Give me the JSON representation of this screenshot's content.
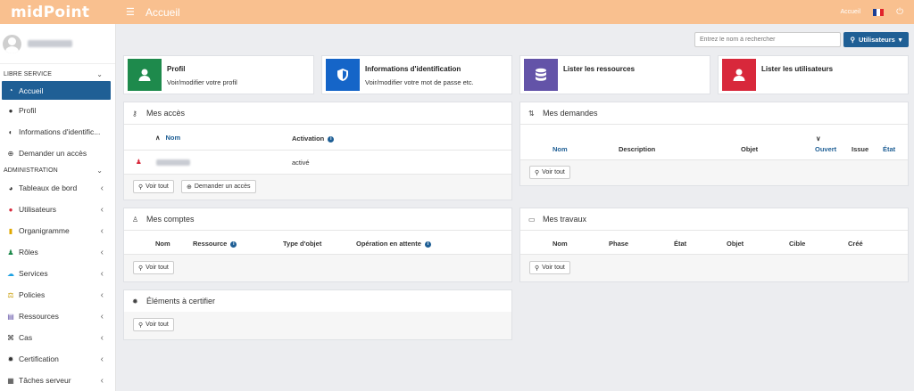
{
  "app": {
    "logo": "midPoint",
    "page_title": "Accueil"
  },
  "topbar": {
    "breadcrumb": "Accueil",
    "flag_colors": [
      "#1c3f94",
      "#ffffff",
      "#e1242b"
    ],
    "power_icon": "power-icon"
  },
  "search": {
    "placeholder": "Entrez le nom à rechercher",
    "type_label": "Utilisateurs"
  },
  "sidebar": {
    "sections": [
      {
        "label": "LIBRE SERVICE"
      },
      {
        "label": "ADMINISTRATION"
      }
    ],
    "self_service": [
      {
        "label": "Accueil",
        "icon": "dashboard-icon",
        "active": true
      },
      {
        "label": "Profil",
        "icon": "user-icon"
      },
      {
        "label": "Informations d'identific...",
        "icon": "shield-icon"
      },
      {
        "label": "Demander un accès",
        "icon": "plus-circle-icon"
      }
    ],
    "admin": [
      {
        "label": "Tableaux de bord",
        "icon": "gauge-icon"
      },
      {
        "label": "Utilisateurs",
        "icon": "user-icon"
      },
      {
        "label": "Organigramme",
        "icon": "building-icon"
      },
      {
        "label": "Rôles",
        "icon": "streetview-icon"
      },
      {
        "label": "Services",
        "icon": "cloud-icon"
      },
      {
        "label": "Policies",
        "icon": "balance-icon"
      },
      {
        "label": "Ressources",
        "icon": "database-icon"
      },
      {
        "label": "Cas",
        "icon": "map-icon"
      },
      {
        "label": "Certification",
        "icon": "certificate-icon"
      },
      {
        "label": "Tâches serveur",
        "icon": "tasks-icon"
      }
    ]
  },
  "tiles": [
    {
      "title": "Profil",
      "subtitle": "Voir/modifier votre profil",
      "color": "#1e8a4c",
      "icon": "user-icon"
    },
    {
      "title": "Informations d'identification",
      "subtitle": "Voir/modifier votre mot de passe etc.",
      "color": "#1565c8",
      "icon": "shield-icon"
    },
    {
      "title": "Lister les ressources",
      "subtitle": "",
      "color": "#6353a8",
      "icon": "database-icon"
    },
    {
      "title": "Lister les utilisateurs",
      "subtitle": "",
      "color": "#d8283b",
      "icon": "user-icon"
    }
  ],
  "cards": {
    "acces": {
      "title": "Mes accès",
      "columns": [
        "Nom",
        "Activation"
      ],
      "rows": [
        {
          "status": "activé"
        }
      ],
      "buttons": [
        "Voir tout",
        "Demander un accès"
      ]
    },
    "demandes": {
      "title": "Mes demandes",
      "columns": [
        "Nom",
        "Description",
        "Objet",
        "Ouvert",
        "Issue",
        "État"
      ],
      "buttons": [
        "Voir tout"
      ]
    },
    "comptes": {
      "title": "Mes comptes",
      "columns": [
        "Nom",
        "Ressource",
        "Type d'objet",
        "Opération en attente"
      ],
      "buttons": [
        "Voir tout"
      ]
    },
    "travaux": {
      "title": "Mes travaux",
      "columns": [
        "Nom",
        "Phase",
        "État",
        "Objet",
        "Cible",
        "Créé"
      ],
      "buttons": [
        "Voir tout"
      ]
    },
    "certifier": {
      "title": "Éléments à certifier",
      "buttons": [
        "Voir tout"
      ]
    }
  }
}
